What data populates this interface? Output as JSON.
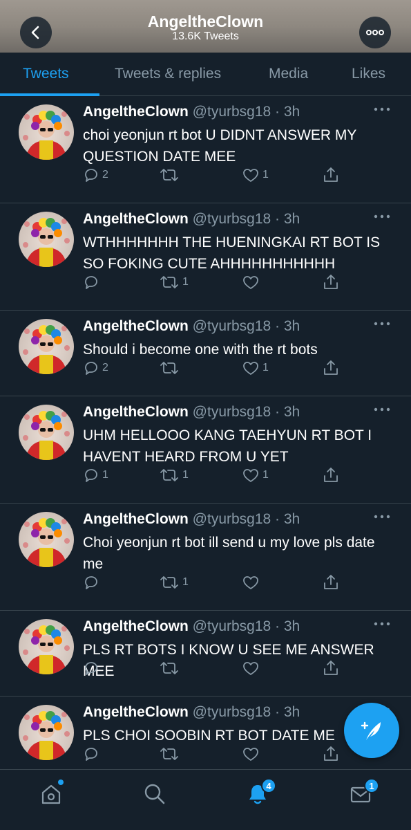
{
  "profile": {
    "name": "AngeltheClown",
    "tweet_count": "13.6K Tweets"
  },
  "tabs": [
    {
      "label": "Tweets",
      "active": true
    },
    {
      "label": "Tweets & replies",
      "active": false
    },
    {
      "label": "Media",
      "active": false
    },
    {
      "label": "Likes",
      "active": false
    }
  ],
  "tweets": [
    {
      "name": "AngeltheClown",
      "handle": "@tyurbsg18 · 3h",
      "text": "choi yeonjun rt bot U DIDNT ANSWER MY QUESTION DATE MEE",
      "replies": "2",
      "retweets": "",
      "likes": "1"
    },
    {
      "name": "AngeltheClown",
      "handle": "@tyurbsg18 · 3h",
      "text": "WTHHHHHHH THE HUENINGKAI RT BOT IS SO FOKING CUTE AHHHHHHHHHHH",
      "replies": "",
      "retweets": "1",
      "likes": ""
    },
    {
      "name": "AngeltheClown",
      "handle": "@tyurbsg18 · 3h",
      "text": "Should i become one with the rt bots",
      "replies": "2",
      "retweets": "",
      "likes": "1"
    },
    {
      "name": "AngeltheClown",
      "handle": "@tyurbsg18 · 3h",
      "text": "UHM HELLOOO KANG TAEHYUN RT BOT I HAVENT HEARD FROM U YET",
      "replies": "1",
      "retweets": "1",
      "likes": "1"
    },
    {
      "name": "AngeltheClown",
      "handle": "@tyurbsg18 · 3h",
      "text": "Choi yeonjun rt bot ill send u my love pls date me",
      "replies": "",
      "retweets": "1",
      "likes": ""
    },
    {
      "name": "AngeltheClown",
      "handle": "@tyurbsg18 · 3h",
      "text": "PLS RT BOTS I KNOW U SEE ME ANSWER MEE",
      "replies": "",
      "retweets": "",
      "likes": ""
    },
    {
      "name": "AngeltheClown",
      "handle": "@tyurbsg18 · 3h",
      "text": "PLS CHOI SOOBIN RT BOT DATE ME",
      "replies": "",
      "retweets": "",
      "likes": ""
    }
  ],
  "bottom_nav": {
    "home_has_dot": true,
    "notifications_badge": "4",
    "messages_badge": "1"
  },
  "colors": {
    "accent": "#1da1f2",
    "background": "#15202b",
    "secondary_text": "#8899a6",
    "divider": "#38444d"
  },
  "icons": [
    "back-arrow-icon",
    "more-icon",
    "reply-icon",
    "retweet-icon",
    "like-icon",
    "share-icon",
    "compose-tweet-icon",
    "home-icon",
    "search-icon",
    "notifications-icon",
    "messages-icon"
  ]
}
